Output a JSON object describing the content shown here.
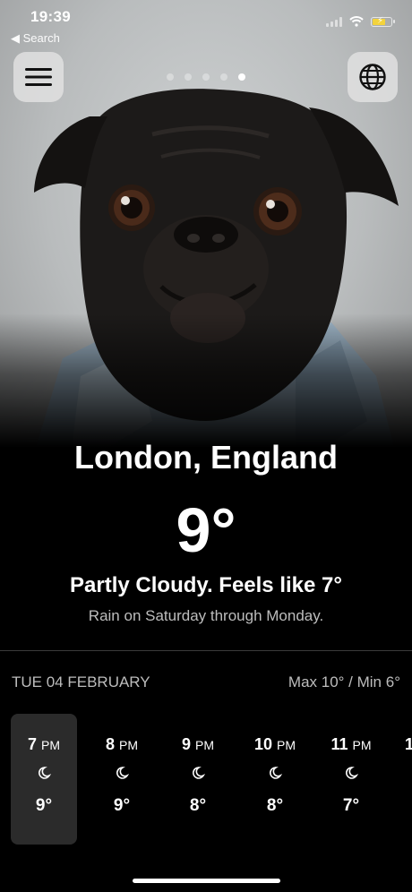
{
  "status_bar": {
    "time": "19:39",
    "back_label": "◀ Search"
  },
  "pager": {
    "count": 5,
    "active_index": 4
  },
  "colors": {
    "background": "#000000",
    "muted_text": "#bdbdbd",
    "selected_hour_bg": "#2b2b2b",
    "battery": "#f3d33c"
  },
  "weather": {
    "city": "London, England",
    "temperature": "9°",
    "condition": "Partly Cloudy. Feels like 7°",
    "summary": "Rain on Saturday through Monday."
  },
  "day": {
    "date": "TUE 04 FEBRUARY",
    "max_min": "Max 10° / Min 6°"
  },
  "hourly": [
    {
      "hour": "7",
      "period": "PM",
      "icon": "moon-icon",
      "temp": "9°",
      "selected": true
    },
    {
      "hour": "8",
      "period": "PM",
      "icon": "moon-icon",
      "temp": "9°",
      "selected": false
    },
    {
      "hour": "9",
      "period": "PM",
      "icon": "moon-icon",
      "temp": "8°",
      "selected": false
    },
    {
      "hour": "10",
      "period": "PM",
      "icon": "moon-icon",
      "temp": "8°",
      "selected": false
    },
    {
      "hour": "11",
      "period": "PM",
      "icon": "moon-icon",
      "temp": "7°",
      "selected": false
    },
    {
      "hour": "1",
      "period": "",
      "icon": "",
      "temp": "",
      "selected": false
    }
  ]
}
